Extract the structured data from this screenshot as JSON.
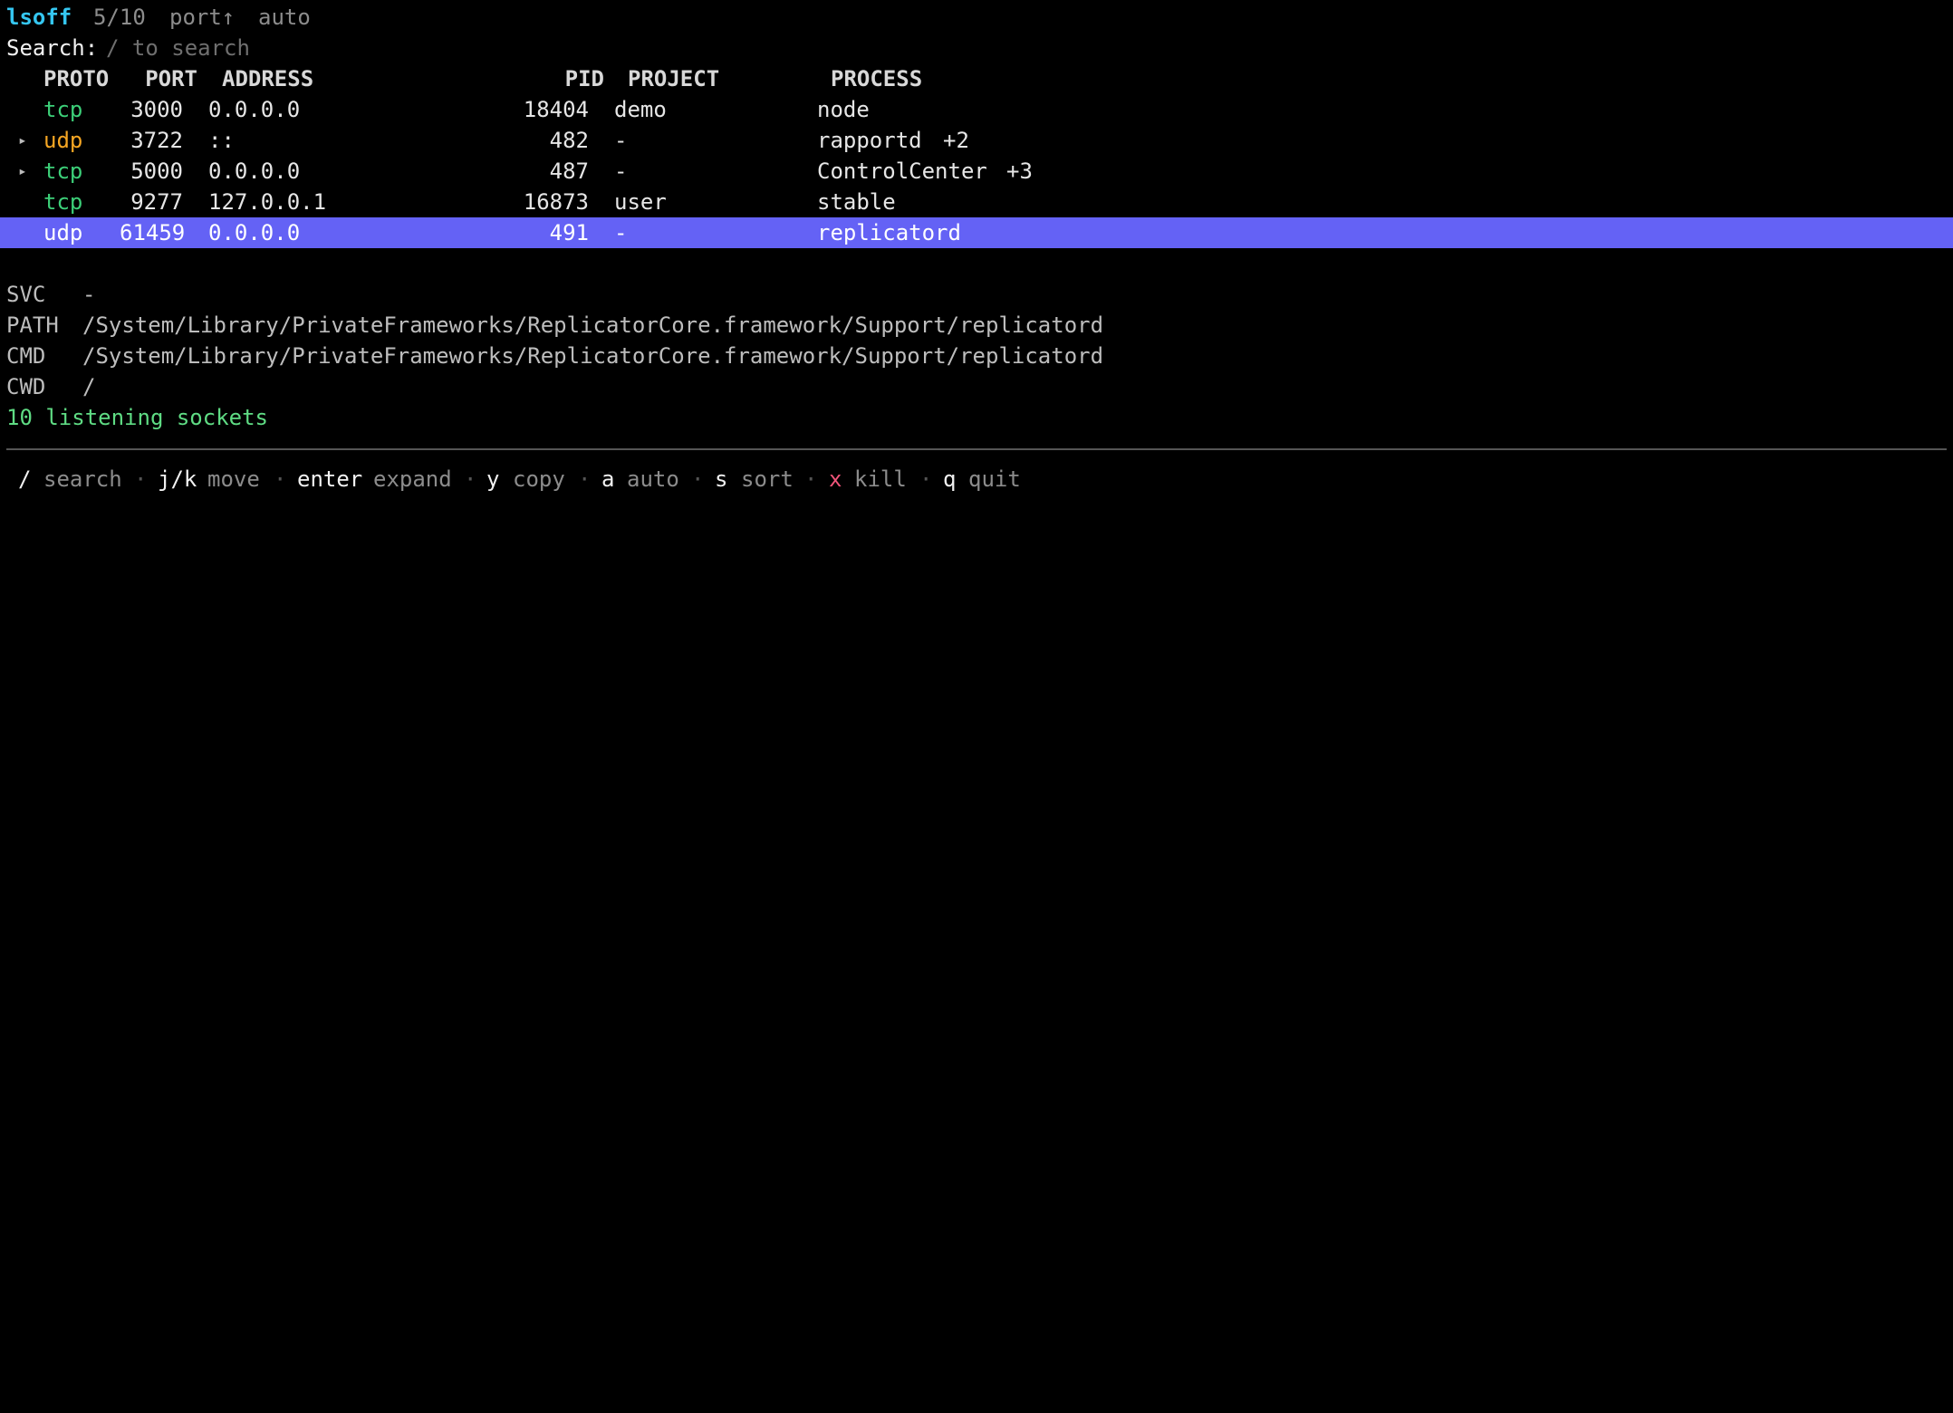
{
  "app": {
    "name": "lsoff",
    "count": "5/10",
    "sort": "port↑",
    "mode": "auto"
  },
  "search": {
    "label": "Search:",
    "placeholder": "/ to search"
  },
  "table": {
    "columns": [
      "PROTO",
      "PORT",
      "ADDRESS",
      "PID",
      "PROJECT",
      "PROCESS"
    ],
    "rows": [
      {
        "expander": "",
        "proto": "tcp",
        "port": "3000",
        "address": "0.0.0.0",
        "pid": "18404",
        "project": "demo",
        "process": "node",
        "extra": ""
      },
      {
        "expander": "▸",
        "proto": "udp",
        "port": "3722",
        "address": "::",
        "pid": "482",
        "project": "-",
        "process": "rapportd",
        "extra": "+2"
      },
      {
        "expander": "▸",
        "proto": "tcp",
        "port": "5000",
        "address": "0.0.0.0",
        "pid": "487",
        "project": "-",
        "process": "ControlCenter",
        "extra": "+3"
      },
      {
        "expander": "",
        "proto": "tcp",
        "port": "9277",
        "address": "127.0.0.1",
        "pid": "16873",
        "project": "user",
        "process": "stable",
        "extra": ""
      },
      {
        "expander": "",
        "proto": "udp",
        "port": "61459",
        "address": "0.0.0.0",
        "pid": "491",
        "project": "-",
        "process": "replicatord",
        "extra": ""
      }
    ],
    "selected_index": 4
  },
  "details": {
    "svc_label": "SVC",
    "svc": "-",
    "path_label": "PATH",
    "path": "/System/Library/PrivateFrameworks/ReplicatorCore.framework/Support/replicatord",
    "cmd_label": "CMD",
    "cmd": "/System/Library/PrivateFrameworks/ReplicatorCore.framework/Support/replicatord",
    "cwd_label": "CWD",
    "cwd": "/",
    "summary": "10 listening sockets"
  },
  "help": {
    "separator": "·",
    "items": [
      {
        "key": "/",
        "action": "search"
      },
      {
        "key": "j/k",
        "action": "move"
      },
      {
        "key": "enter",
        "action": "expand"
      },
      {
        "key": "y",
        "action": "copy"
      },
      {
        "key": "a",
        "action": "auto"
      },
      {
        "key": "s",
        "action": "sort"
      },
      {
        "key": "x",
        "action": "kill"
      },
      {
        "key": "q",
        "action": "quit"
      }
    ]
  },
  "colors": {
    "selection": "#6462f5",
    "tcp": "#3ccf78",
    "udp": "#f5a623",
    "accent": "#35c6f0",
    "summary": "#5fdc84",
    "kill_key": "#f2557a"
  }
}
